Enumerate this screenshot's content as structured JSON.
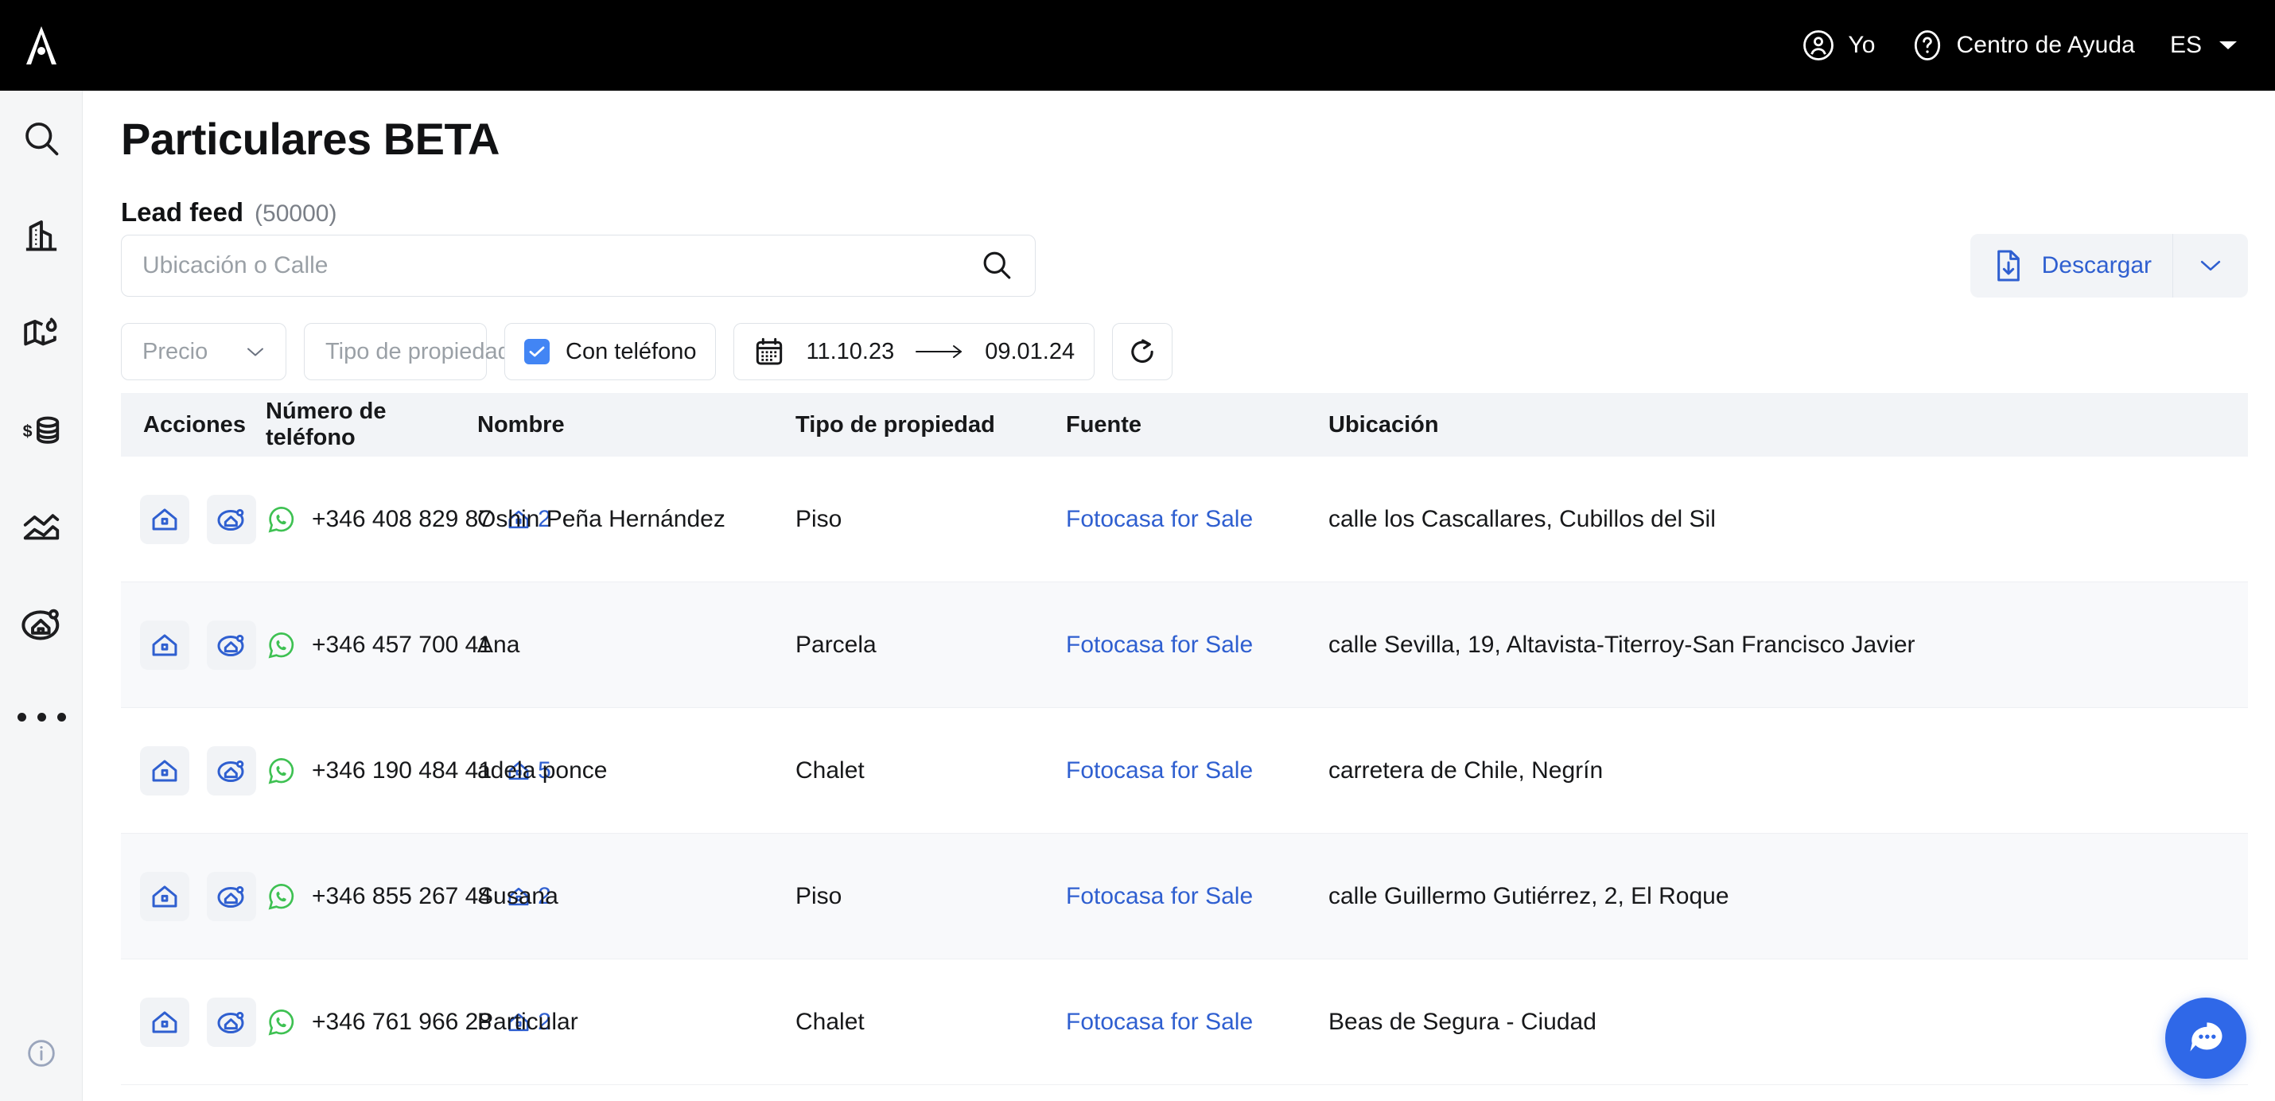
{
  "topbar": {
    "logo_icon": "brand-a-logo",
    "account": {
      "label": "Yo",
      "icon": "user-circle-icon"
    },
    "help": {
      "label": "Centro de Ayuda",
      "icon": "question-circle-icon"
    },
    "language": {
      "label": "ES",
      "icon": "chevron-down-icon"
    }
  },
  "sidebar": {
    "items": [
      {
        "icon": "search-icon",
        "name": "search"
      },
      {
        "icon": "building-icon",
        "name": "buildings"
      },
      {
        "icon": "map-flame-icon",
        "name": "map-hot"
      },
      {
        "icon": "dollar-coins-icon",
        "name": "valuation"
      },
      {
        "icon": "chart-line-icon",
        "name": "analytics"
      },
      {
        "icon": "house-search-icon",
        "name": "leads"
      },
      {
        "icon": "more-dots-icon",
        "name": "more"
      }
    ],
    "bottom": {
      "icon": "info-circle-icon",
      "name": "info"
    }
  },
  "page": {
    "title": "Particulares BETA",
    "feed_label": "Lead feed",
    "feed_count": "(50000)"
  },
  "search": {
    "placeholder": "Ubicación o Calle",
    "value": "",
    "icon": "search-icon"
  },
  "filters": {
    "price": {
      "label": "Precio",
      "icon": "chevron-down-icon"
    },
    "property_type": {
      "label": "Tipo de propiedad",
      "icon": "chevron-down-icon"
    },
    "with_phone": {
      "label": "Con teléfono",
      "checked": true,
      "icon": "checkbox-checked-icon"
    },
    "date_range": {
      "icon": "calendar-icon",
      "from": "11.10.23",
      "arrow": "→",
      "to": "09.01.24"
    },
    "refresh": {
      "icon": "refresh-icon",
      "label": ""
    }
  },
  "download": {
    "label": "Descargar",
    "icon": "file-download-icon",
    "caret_icon": "chevron-down-icon"
  },
  "table": {
    "columns": [
      "Acciones",
      "Número de teléfono",
      "Nombre",
      "Tipo de propiedad",
      "Fuente",
      "Ubicación"
    ],
    "row_actions": [
      {
        "icon": "house-icon",
        "name": "view-property"
      },
      {
        "icon": "house-tracked-icon",
        "name": "track-property"
      }
    ],
    "rows": [
      {
        "phone": "+346 408 829 87",
        "phone_icon": "whatsapp-icon",
        "listings_count": "2",
        "listings_icon": "house-icon",
        "name": "Oshin Peña Hernández",
        "property_type": "Piso",
        "source": "Fotocasa for Sale",
        "location": "calle los Cascallares, Cubillos del Sil"
      },
      {
        "phone": "+346 457 700 41",
        "phone_icon": "whatsapp-icon",
        "listings_count": "",
        "listings_icon": "",
        "name": "Ana",
        "property_type": "Parcela",
        "source": "Fotocasa for Sale",
        "location": "calle Sevilla, 19, Altavista-Titerroy-San Francisco Javier"
      },
      {
        "phone": "+346 190 484 41",
        "phone_icon": "whatsapp-icon",
        "listings_count": "5",
        "listings_icon": "house-icon",
        "name": "adela ponce",
        "property_type": "Chalet",
        "source": "Fotocasa for Sale",
        "location": "carretera de Chile, Negrín"
      },
      {
        "phone": "+346 855 267 44",
        "phone_icon": "whatsapp-icon",
        "listings_count": "2",
        "listings_icon": "house-icon",
        "name": "Susana",
        "property_type": "Piso",
        "source": "Fotocasa for Sale",
        "location": "calle Guillermo Gutiérrez, 2, El Roque"
      },
      {
        "phone": "+346 761 966 28",
        "phone_icon": "whatsapp-icon",
        "listings_count": "2",
        "listings_icon": "house-icon",
        "name": "Particular",
        "property_type": "Chalet",
        "source": "Fotocasa for Sale",
        "location": "Beas de Segura - Ciudad"
      }
    ]
  },
  "chat_widget": {
    "icon": "chat-bubble-dots-icon"
  },
  "colors": {
    "brand_black": "#000000",
    "accent_blue": "#2f5fd0",
    "checkbox_blue": "#4285f4",
    "whatsapp_green": "#3ec152",
    "chat_blue": "#2f68e8",
    "header_gray": "#f2f4f7",
    "row_alt": "#f8f9fb",
    "sidebar_gray": "#f5f6f7"
  }
}
